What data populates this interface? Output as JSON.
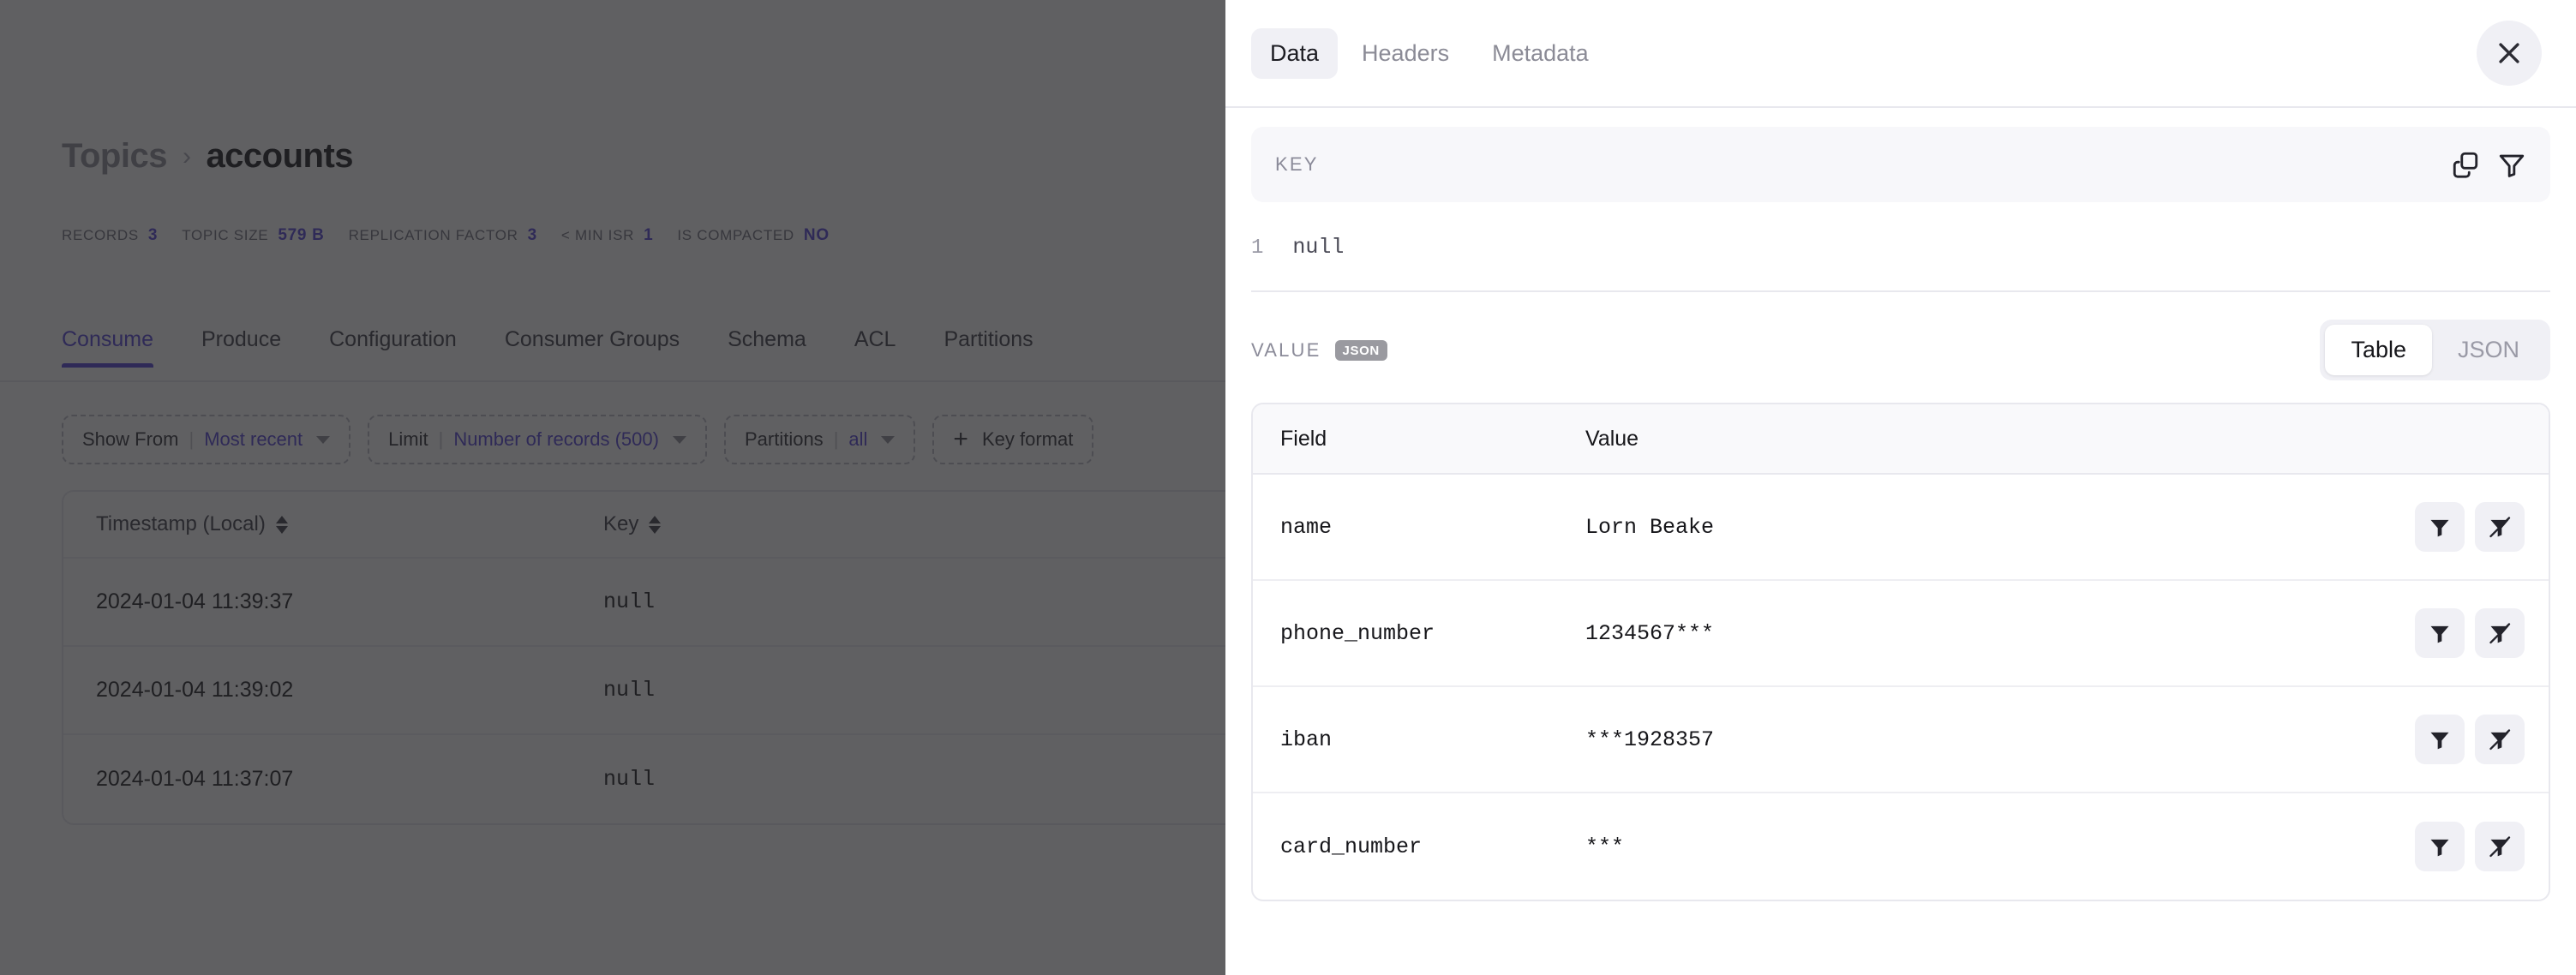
{
  "background": {
    "breadcrumb": {
      "parent": "Topics",
      "separator": "›",
      "current": "accounts"
    },
    "metrics": [
      {
        "label": "RECORDS",
        "value": "3"
      },
      {
        "label": "TOPIC SIZE",
        "value": "579 B"
      },
      {
        "label": "REPLICATION FACTOR",
        "value": "3"
      },
      {
        "label": "< MIN ISR",
        "value": "1"
      },
      {
        "label": "IS COMPACTED",
        "value": "NO"
      }
    ],
    "tabs": [
      {
        "label": "Consume",
        "active": true
      },
      {
        "label": "Produce",
        "active": false
      },
      {
        "label": "Configuration",
        "active": false
      },
      {
        "label": "Consumer Groups",
        "active": false
      },
      {
        "label": "Schema",
        "active": false
      },
      {
        "label": "ACL",
        "active": false
      },
      {
        "label": "Partitions",
        "active": false
      }
    ],
    "filters": [
      {
        "label": "Show From",
        "value": "Most recent",
        "type": "select"
      },
      {
        "label": "Limit",
        "value": "Number of records (500)",
        "type": "select"
      },
      {
        "label": "Partitions",
        "value": "all",
        "type": "select"
      },
      {
        "label": "Key format",
        "value": "",
        "type": "add"
      }
    ],
    "table": {
      "columns": [
        "Timestamp (Local)",
        "Key"
      ],
      "rows": [
        {
          "timestamp": "2024-01-04 11:39:37",
          "key": "null"
        },
        {
          "timestamp": "2024-01-04 11:39:02",
          "key": "null"
        },
        {
          "timestamp": "2024-01-04 11:37:07",
          "key": "null"
        }
      ]
    }
  },
  "panel": {
    "tabs": [
      {
        "label": "Data",
        "active": true
      },
      {
        "label": "Headers",
        "active": false
      },
      {
        "label": "Metadata",
        "active": false
      }
    ],
    "close_label": "close",
    "key_section": {
      "label": "KEY",
      "copy_icon": "copy-icon",
      "filter_icon": "filter-icon",
      "line_number": "1",
      "content": "null"
    },
    "value_section": {
      "label": "VALUE",
      "badge": "JSON",
      "view_toggle": [
        {
          "label": "Table",
          "active": true
        },
        {
          "label": "JSON",
          "active": false
        }
      ],
      "columns": [
        "Field",
        "Value"
      ],
      "rows": [
        {
          "field": "name",
          "value": "Lorn Beake"
        },
        {
          "field": "phone_number",
          "value": "1234567***"
        },
        {
          "field": "iban",
          "value": "***1928357"
        },
        {
          "field": "card_number",
          "value": "***"
        }
      ],
      "row_action_filter": "filter-icon",
      "row_action_filter_out": "filter-off-icon"
    }
  },
  "colors": {
    "accent": "#4f3fd6",
    "panel_bg": "#ffffff",
    "scrim": "#232326",
    "muted": "#8b8b96",
    "surface": "#f0f0f5"
  }
}
